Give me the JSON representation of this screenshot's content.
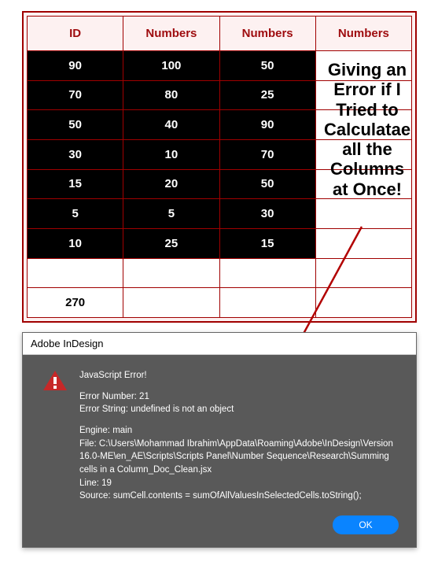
{
  "table": {
    "headers": [
      "ID",
      "Numbers",
      "Numbers",
      "Numbers"
    ],
    "data_rows": [
      [
        "90",
        "100",
        "50"
      ],
      [
        "70",
        "80",
        "25"
      ],
      [
        "50",
        "40",
        "90"
      ],
      [
        "30",
        "10",
        "70"
      ],
      [
        "15",
        "20",
        "50"
      ],
      [
        "5",
        "5",
        "30"
      ],
      [
        "10",
        "25",
        "15"
      ]
    ],
    "sum_cell": "270"
  },
  "overlay": {
    "text": "Giving an Error if I Tried to Calculatae all the Columns at Once!"
  },
  "dialog": {
    "title": "Adobe InDesign",
    "error_heading": "JavaScript Error!",
    "error_number_label": "Error Number: ",
    "error_number": "21",
    "error_string_label": "Error String: ",
    "error_string": "undefined is not an object",
    "engine_label": "Engine: ",
    "engine": "main",
    "file_label": "File: ",
    "file": "C:\\Users\\Mohammad Ibrahim\\AppData\\Roaming\\Adobe\\InDesign\\Version 16.0-ME\\en_AE\\Scripts\\Scripts Panel\\Number Sequence\\Research\\Summing cells in a Column_Doc_Clean.jsx",
    "line_label": "Line: ",
    "line": "19",
    "source_label": "Source:  ",
    "source": "sumCell.contents = sumOfAllValuesInSelectedCells.toString();",
    "ok_label": "OK"
  }
}
